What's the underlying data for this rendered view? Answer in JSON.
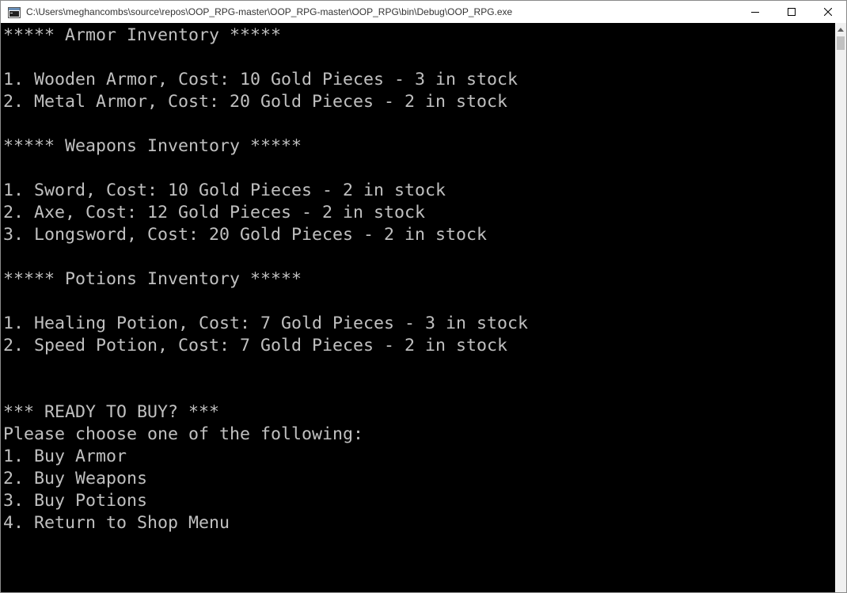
{
  "window": {
    "title": "C:\\Users\\meghancombs\\source\\repos\\OOP_RPG-master\\OOP_RPG-master\\OOP_RPG\\bin\\Debug\\OOP_RPG.exe",
    "icons": {
      "app": "console-app-icon",
      "minimize": "minimize-icon",
      "maximize": "maximize-icon",
      "close": "close-icon"
    }
  },
  "console": {
    "lines": [
      "***** Armor Inventory *****",
      "",
      "1. Wooden Armor, Cost: 10 Gold Pieces - 3 in stock",
      "2. Metal Armor, Cost: 20 Gold Pieces - 2 in stock",
      "",
      "***** Weapons Inventory *****",
      "",
      "1. Sword, Cost: 10 Gold Pieces - 2 in stock",
      "2. Axe, Cost: 12 Gold Pieces - 2 in stock",
      "3. Longsword, Cost: 20 Gold Pieces - 2 in stock",
      "",
      "***** Potions Inventory *****",
      "",
      "1. Healing Potion, Cost: 7 Gold Pieces - 3 in stock",
      "2. Speed Potion, Cost: 7 Gold Pieces - 2 in stock",
      "",
      "",
      "*** READY TO BUY? ***",
      "Please choose one of the following:",
      "1. Buy Armor",
      "2. Buy Weapons",
      "3. Buy Potions",
      "4. Return to Shop Menu"
    ]
  },
  "colors": {
    "console_bg": "#000000",
    "console_fg": "#c0c0c0",
    "titlebar_bg": "#ffffff"
  }
}
